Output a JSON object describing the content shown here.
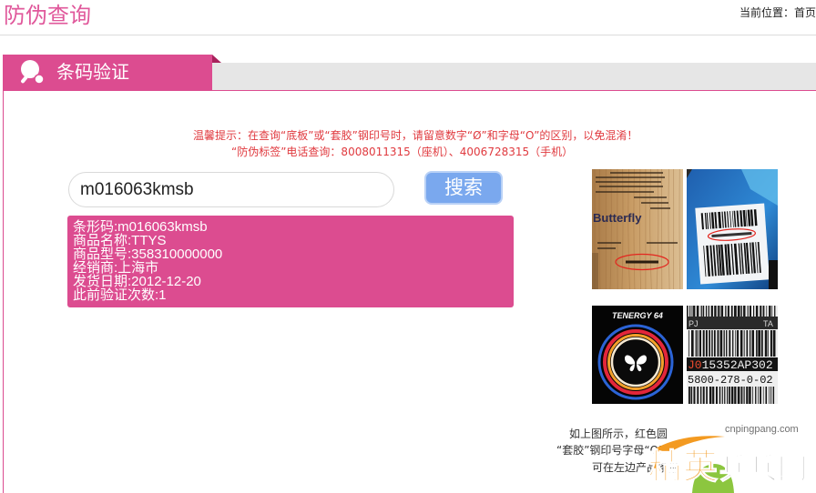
{
  "header": {
    "title": "防伪查询",
    "location_label": "当前位置：",
    "home_link": "首页"
  },
  "tab": {
    "label": "条码验证",
    "icon": "ping-pong-paddle-icon"
  },
  "notice": {
    "line1": "温馨提示：在查询“底板”或“套胶”钢印号时，请留意数字“Ø”和字母“O”的区别，以免混淆！",
    "line2": "“防伪标签”电话查询：8008011315（座机）、4006728315（手机）"
  },
  "search": {
    "value": "m016063kmsb",
    "button_label": "搜索"
  },
  "result": {
    "lines": [
      "条形码:m016063kmsb",
      "商品名称:TTYS",
      "商品型号:358310000000",
      "经销商:上海市",
      "发货日期:2012-12-20",
      "此前验证次数:1"
    ]
  },
  "samples": {
    "blade_brand": "Butterfly",
    "rubber_name": "TENERGY 64",
    "label_top_left": "PJ",
    "label_top_right": "TA",
    "label_code_prefix": "J0",
    "label_code_rest": "15352AP302",
    "label_code2": "5800-278-0-02"
  },
  "help": {
    "line1": "如上图所示，红色圆",
    "line2": "“套胶”钢印号字母“O”",
    "line3": "可在左边产品条形"
  },
  "watermark": {
    "site": "cnpingpang.com",
    "brand_a": "精英",
    "brand_b": "乒乓网"
  },
  "theme": {
    "primary": "#dc4c90",
    "title": "#e0589b",
    "notice": "#e03a3f",
    "button": "#7aa8ee",
    "button_rim": "#b9d1f6",
    "tab_strip": "#e6e6e6",
    "tab_fold": "#a8225c"
  }
}
